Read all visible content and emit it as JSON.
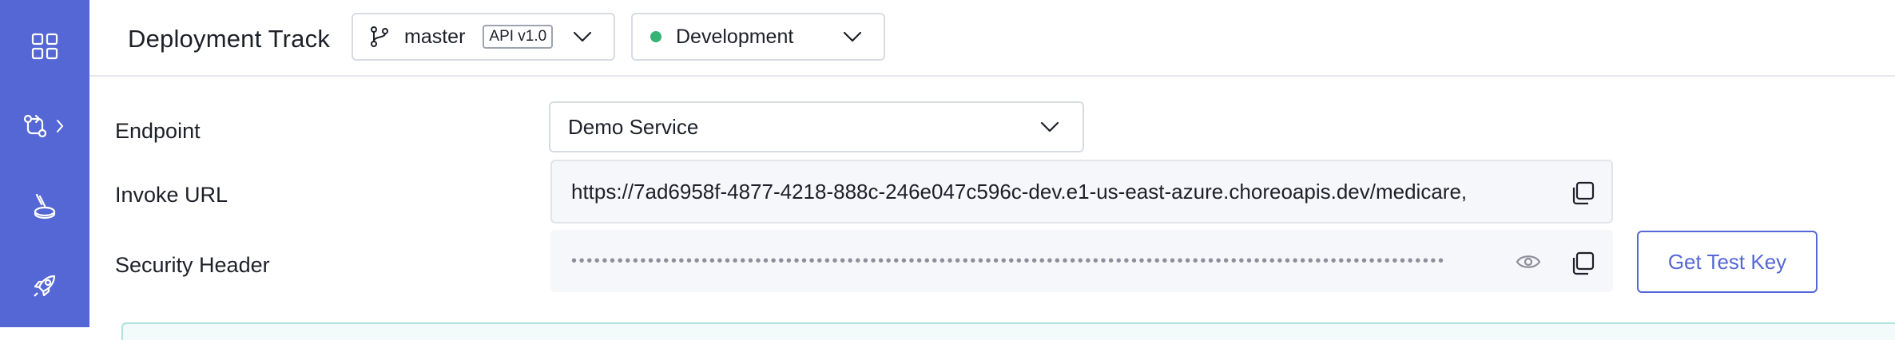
{
  "header": {
    "title": "Deployment Track",
    "branch": {
      "name": "master",
      "api_version": "API v1.0"
    },
    "environment": {
      "name": "Development",
      "status_color": "#36b475"
    }
  },
  "sidebar": {
    "items": [
      {
        "icon": "overview-grid-icon"
      },
      {
        "icon": "develop-icon",
        "has_submenu": true
      },
      {
        "icon": "test-icon"
      },
      {
        "icon": "deploy-rocket-icon"
      }
    ],
    "color": "#5567d5"
  },
  "form": {
    "endpoint": {
      "label": "Endpoint",
      "value": "Demo Service"
    },
    "invoke_url": {
      "label": "Invoke URL",
      "value": "https://7ad6958f-4877-4218-888c-246e047c596c-dev.e1-us-east-azure.choreoapis.dev/medicare,"
    },
    "security_header": {
      "label": "Security Header",
      "masked_value": "••••••••••••••••••••••••••••••••••••••••••••••••••••••••••••••••••••••••••••••••••••••••••••••••••••••••••••••••••"
    },
    "get_test_key_label": "Get Test Key"
  },
  "colors": {
    "accent": "#5567d5",
    "field_bg": "#f6f7fb"
  }
}
